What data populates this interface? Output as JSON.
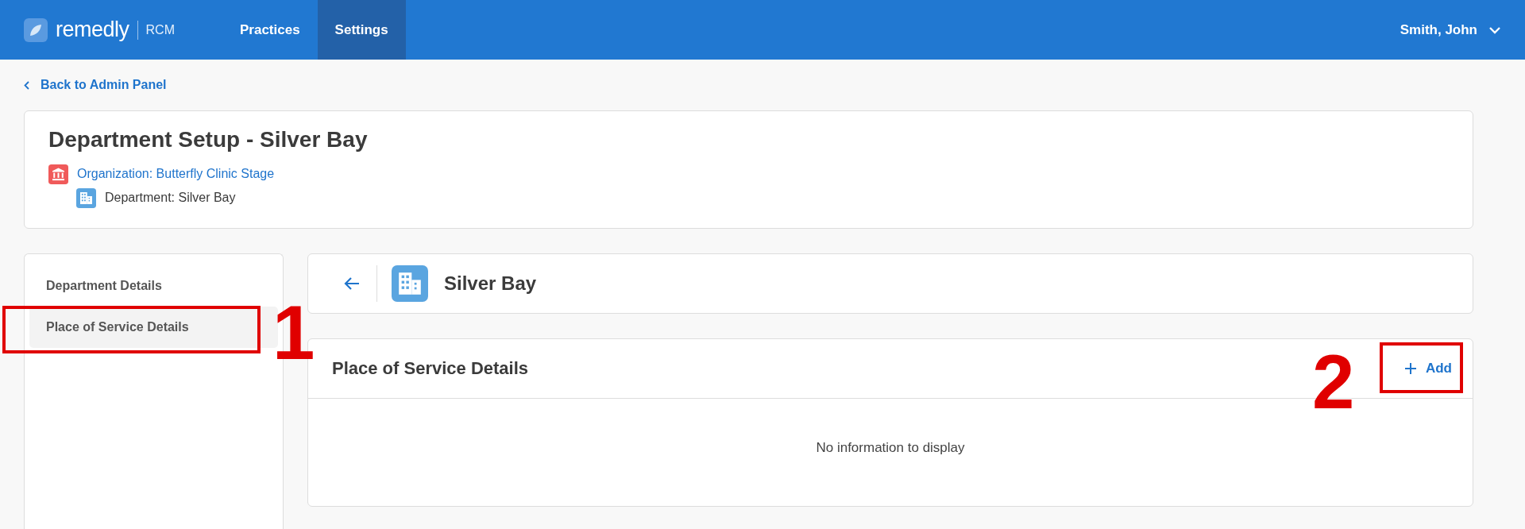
{
  "header": {
    "logo": {
      "name": "remedly",
      "product": "RCM"
    },
    "nav": [
      {
        "label": "Practices",
        "selected": false
      },
      {
        "label": "Settings",
        "selected": true
      }
    ],
    "user": {
      "name": "Smith, John"
    }
  },
  "back_link": {
    "label": "Back to Admin Panel"
  },
  "page_card": {
    "title": "Department Setup - Silver Bay",
    "breadcrumbs": [
      {
        "kind": "organization",
        "text": "Organization: Butterfly Clinic Stage"
      },
      {
        "kind": "department",
        "text": "Department: Silver Bay"
      }
    ]
  },
  "sidebar": {
    "items": [
      {
        "label": "Department Details",
        "selected": false
      },
      {
        "label": "Place of Service Details",
        "selected": true
      }
    ]
  },
  "detail_header": {
    "title": "Silver Bay"
  },
  "section": {
    "title": "Place of Service Details",
    "add_button": {
      "label": "Add"
    },
    "empty_message": "No information to display"
  },
  "annotations": [
    {
      "label": "1"
    },
    {
      "label": "2"
    }
  ]
}
